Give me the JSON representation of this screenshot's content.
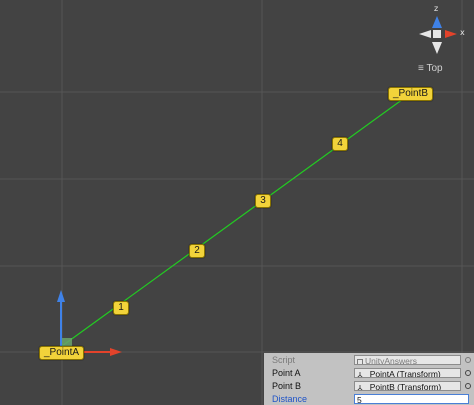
{
  "viewport": {
    "view_label": "Top",
    "axis_labels": {
      "x": "x",
      "z": "z"
    },
    "point_labels": {
      "a": "_PointA",
      "b": "_PointB"
    },
    "markers": [
      "1",
      "2",
      "3",
      "4"
    ],
    "colors": {
      "background": "#434343",
      "grid": "#565656",
      "line": "#22cc22",
      "label": "#f2d33a",
      "x_axis": "#e3432b",
      "y_axis": "#3f82e8"
    }
  },
  "inspector": {
    "script": {
      "label": "Script",
      "value": "UnityAnswers"
    },
    "point_a": {
      "label": "Point A",
      "value": "_PointA (Transform)"
    },
    "point_b": {
      "label": "Point B",
      "value": "_PointB (Transform)"
    },
    "distance": {
      "label": "Distance",
      "value": "5"
    }
  }
}
